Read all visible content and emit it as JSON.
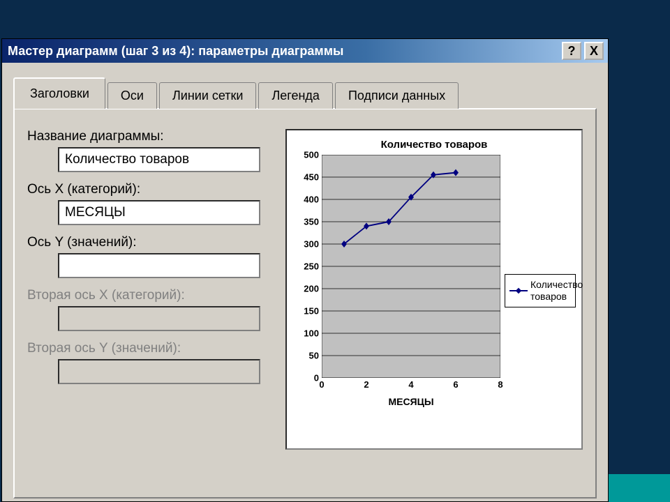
{
  "window": {
    "title": "Мастер диаграмм (шаг 3 из 4): параметры диаграммы",
    "help": "?",
    "close": "X"
  },
  "tabs": {
    "t0": "Заголовки",
    "t1": "Оси",
    "t2": "Линии сетки",
    "t3": "Легенда",
    "t4": "Подписи данных"
  },
  "fields": {
    "chart_title_label": "Название диаграммы:",
    "chart_title_value": "Количество товаров",
    "x_axis_label": "Ось X (категорий):",
    "x_axis_value": "МЕСЯЦЫ",
    "y_axis_label": "Ось Y (значений):",
    "y_axis_value": "",
    "x2_axis_label": "Вторая ось X (категорий):",
    "y2_axis_label": "Вторая ось Y (значений):"
  },
  "legend": {
    "series1": "Количество товаров"
  },
  "chart_data": {
    "type": "line",
    "title": "Количество товаров",
    "xlabel": "МЕСЯЦЫ",
    "ylabel": "",
    "xlim": [
      0,
      8
    ],
    "ylim": [
      0,
      500
    ],
    "x_ticks": [
      0,
      2,
      4,
      6,
      8
    ],
    "y_ticks": [
      0,
      50,
      100,
      150,
      200,
      250,
      300,
      350,
      400,
      450,
      500
    ],
    "series": [
      {
        "name": "Количество товаров",
        "x": [
          1,
          2,
          3,
          4,
          5,
          6
        ],
        "y": [
          300,
          340,
          350,
          405,
          455,
          460
        ]
      }
    ],
    "grid": true,
    "legend_position": "right"
  }
}
